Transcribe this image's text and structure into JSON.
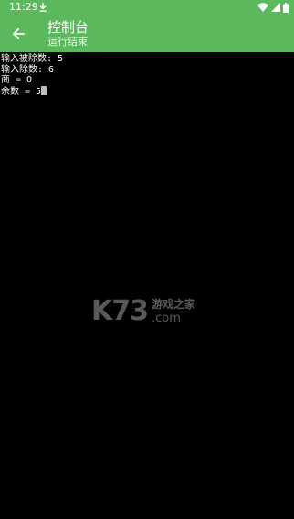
{
  "status_bar": {
    "time": "11:29",
    "icons": [
      "download-icon",
      "wifi-icon",
      "cellular-signal-icon",
      "battery-icon"
    ]
  },
  "app_bar": {
    "back_icon": "arrow-back-icon",
    "title": "控制台",
    "subtitle": "运行结束",
    "color": "#5cb85c"
  },
  "console": {
    "lines": [
      "输入被除数: 5",
      "输入除数: 6",
      "商 = 0",
      "余数 = 5"
    ],
    "background": "#000000",
    "text_color": "#ffffff"
  },
  "watermark": {
    "logo": "K73",
    "name": "游戏之家",
    "domain": ".com"
  }
}
